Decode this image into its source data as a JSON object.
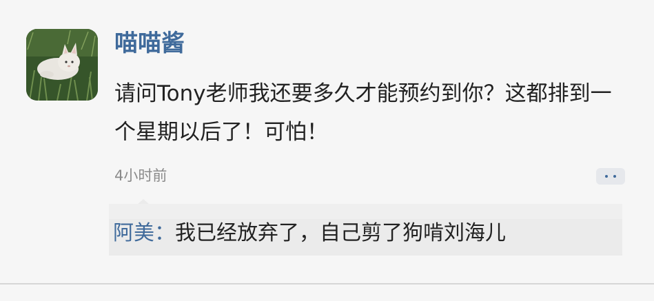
{
  "post": {
    "username": "喵喵酱",
    "content": "请问Tony老师我还要多久才能预约到你？这都排到一个星期以后了！可怕！",
    "timestamp": "4小时前",
    "avatar_icon": "cat-on-grass-avatar",
    "more_icon": "more-dots-icon"
  },
  "reply": {
    "author": "阿美",
    "separator": "：",
    "text": "我已经放弃了，自己剪了狗啃刘海儿"
  },
  "colors": {
    "username": "#3f6a9b",
    "text": "#222222",
    "timestamp": "#8a8a8a",
    "background": "#f6f6f6",
    "reply_background": "#ebebeb"
  }
}
